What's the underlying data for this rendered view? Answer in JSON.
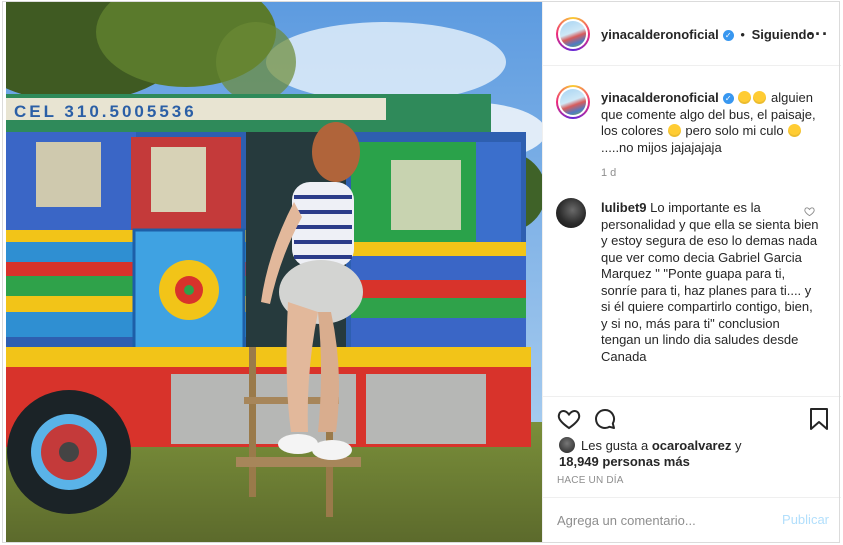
{
  "post": {
    "username": "yinacalderonoficial",
    "separator": "•",
    "follow_label": "Siguiendo",
    "more_icon": "more-options-icon",
    "verified_icon": "verified-badge-icon",
    "caption_line1": "alguien que comente algo del bus, el paisaje, los colores",
    "caption_line2": "pero solo mi culo",
    "caption_line3": ".....no mijos jajajajaja",
    "caption_time": "1 d",
    "photo_sign_text": "CEL 310.5005536"
  },
  "comment": {
    "username": "lulibet9",
    "text": "Lo importante es la personalidad y que ella se sienta bien y estoy segura de eso lo demas nada que ver como decia Gabriel Garcia Marquez \" \"Ponte guapa para ti, sonríe para ti, haz planes para ti.... y si él quiere compartirlo contigo, bien, y si no, más para ti\" conclusion tengan un lindo dia saludes desde Canada"
  },
  "actions": {
    "like_icon": "heart-icon",
    "comment_icon": "comment-icon",
    "save_icon": "bookmark-icon",
    "likes_prefix": "Les gusta a",
    "likes_user": "ocaroalvarez",
    "likes_conj": "y",
    "likes_count": "18,949 personas más",
    "time_ago": "HACE UN DÍA"
  },
  "composer": {
    "placeholder": "Agrega un comentario...",
    "publish_label": "Publicar"
  },
  "colors": {
    "verified": "#3897f0",
    "publish_disabled": "#b2dffc",
    "secondary_text": "#8e8e8e"
  }
}
